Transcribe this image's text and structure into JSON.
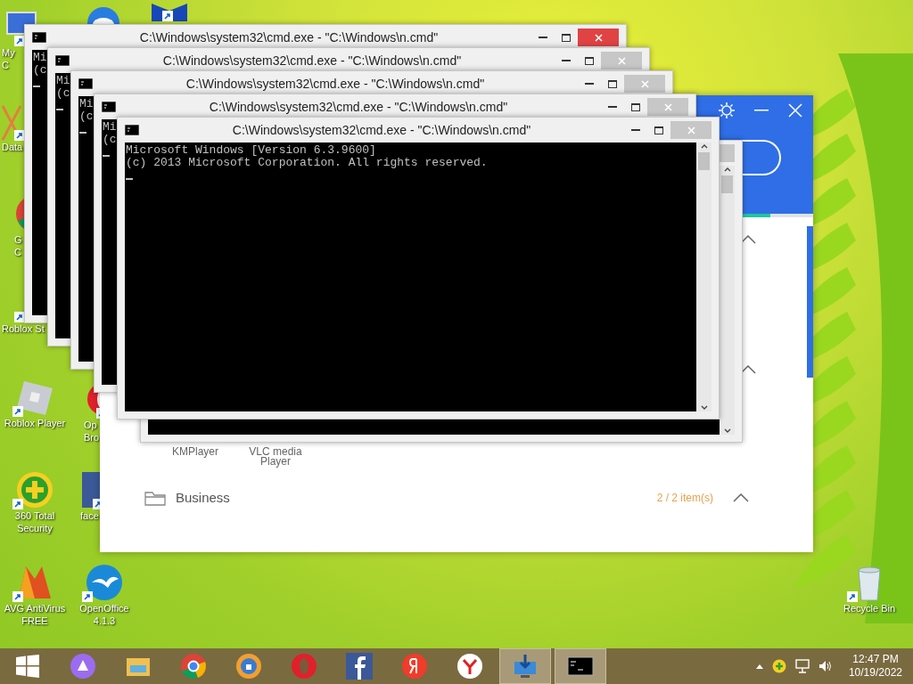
{
  "desktop_icons": [
    {
      "kind": "computer",
      "label": "My C"
    },
    {
      "kind": "database",
      "label": "Data"
    },
    {
      "kind": "chrome",
      "label": "G C"
    },
    {
      "kind": "roblox-studio",
      "label": "Roblox St"
    },
    {
      "kind": "roblox",
      "label": "Roblox Player"
    },
    {
      "kind": "antivirus",
      "label": "360 Total Security"
    },
    {
      "kind": "avg",
      "label": "AVG AntiVirus FREE"
    },
    {
      "kind": "bird"
    },
    {
      "kind": "shield"
    },
    {
      "kind": "opera",
      "label": "Op Bro"
    },
    {
      "kind": "facebook",
      "label": "face"
    },
    {
      "kind": "openoffice",
      "label": "OpenOffice 4.1.3"
    },
    {
      "kind": "recycle-bin",
      "label": "Recycle Bin"
    }
  ],
  "app_window": {
    "apps": [
      {
        "label": "KMPlayer"
      },
      {
        "label": "VLC media Player"
      }
    ],
    "progress": {
      "level": 0.4
    },
    "group": {
      "name": "Business",
      "count": "2 / 2 item(s)",
      "expanded": true
    }
  },
  "cmd_windows": [
    {
      "active": false
    },
    {
      "title": "C:\\Windows\\system32\\cmd.exe - \"C:\\Windows\\n.cmd\"",
      "active": true,
      "lines": [
        "Mi",
        "(c"
      ]
    },
    {
      "title": "C:\\Windows\\system32\\cmd.exe - \"C:\\Windows\\n.cmd\"",
      "active": false,
      "lines": [
        "Mi",
        "(c"
      ]
    },
    {
      "title": "C:\\Windows\\system32\\cmd.exe - \"C:\\Windows\\n.cmd\"",
      "active": false,
      "lines": [
        "Mi",
        "(c"
      ]
    },
    {
      "title": "C:\\Windows\\system32\\cmd.exe - \"C:\\Windows\\n.cmd\"",
      "active": false,
      "lines": [
        "Mi",
        "(c"
      ]
    },
    {
      "title": "C:\\Windows\\system32\\cmd.exe - \"C:\\Windows\\n.cmd\"",
      "active": false,
      "lines": [
        "Microsoft Windows [Version 6.3.9600]",
        "(c) 2013 Microsoft Corporation. All rights reserved."
      ]
    }
  ],
  "taskbar": {
    "items": [
      {
        "kind": "start",
        "open": false
      },
      {
        "kind": "assistant",
        "open": false
      },
      {
        "kind": "explorer",
        "open": false
      },
      {
        "kind": "chrome",
        "open": false
      },
      {
        "kind": "browser",
        "open": false
      },
      {
        "kind": "opera",
        "open": false
      },
      {
        "kind": "facebook",
        "open": false
      },
      {
        "kind": "yandex",
        "open": false
      },
      {
        "kind": "yandex-browser",
        "open": false
      },
      {
        "kind": "installer",
        "open": true
      },
      {
        "kind": "console",
        "open": true
      }
    ],
    "time": "12:47 PM",
    "date": "10/19/2022"
  }
}
